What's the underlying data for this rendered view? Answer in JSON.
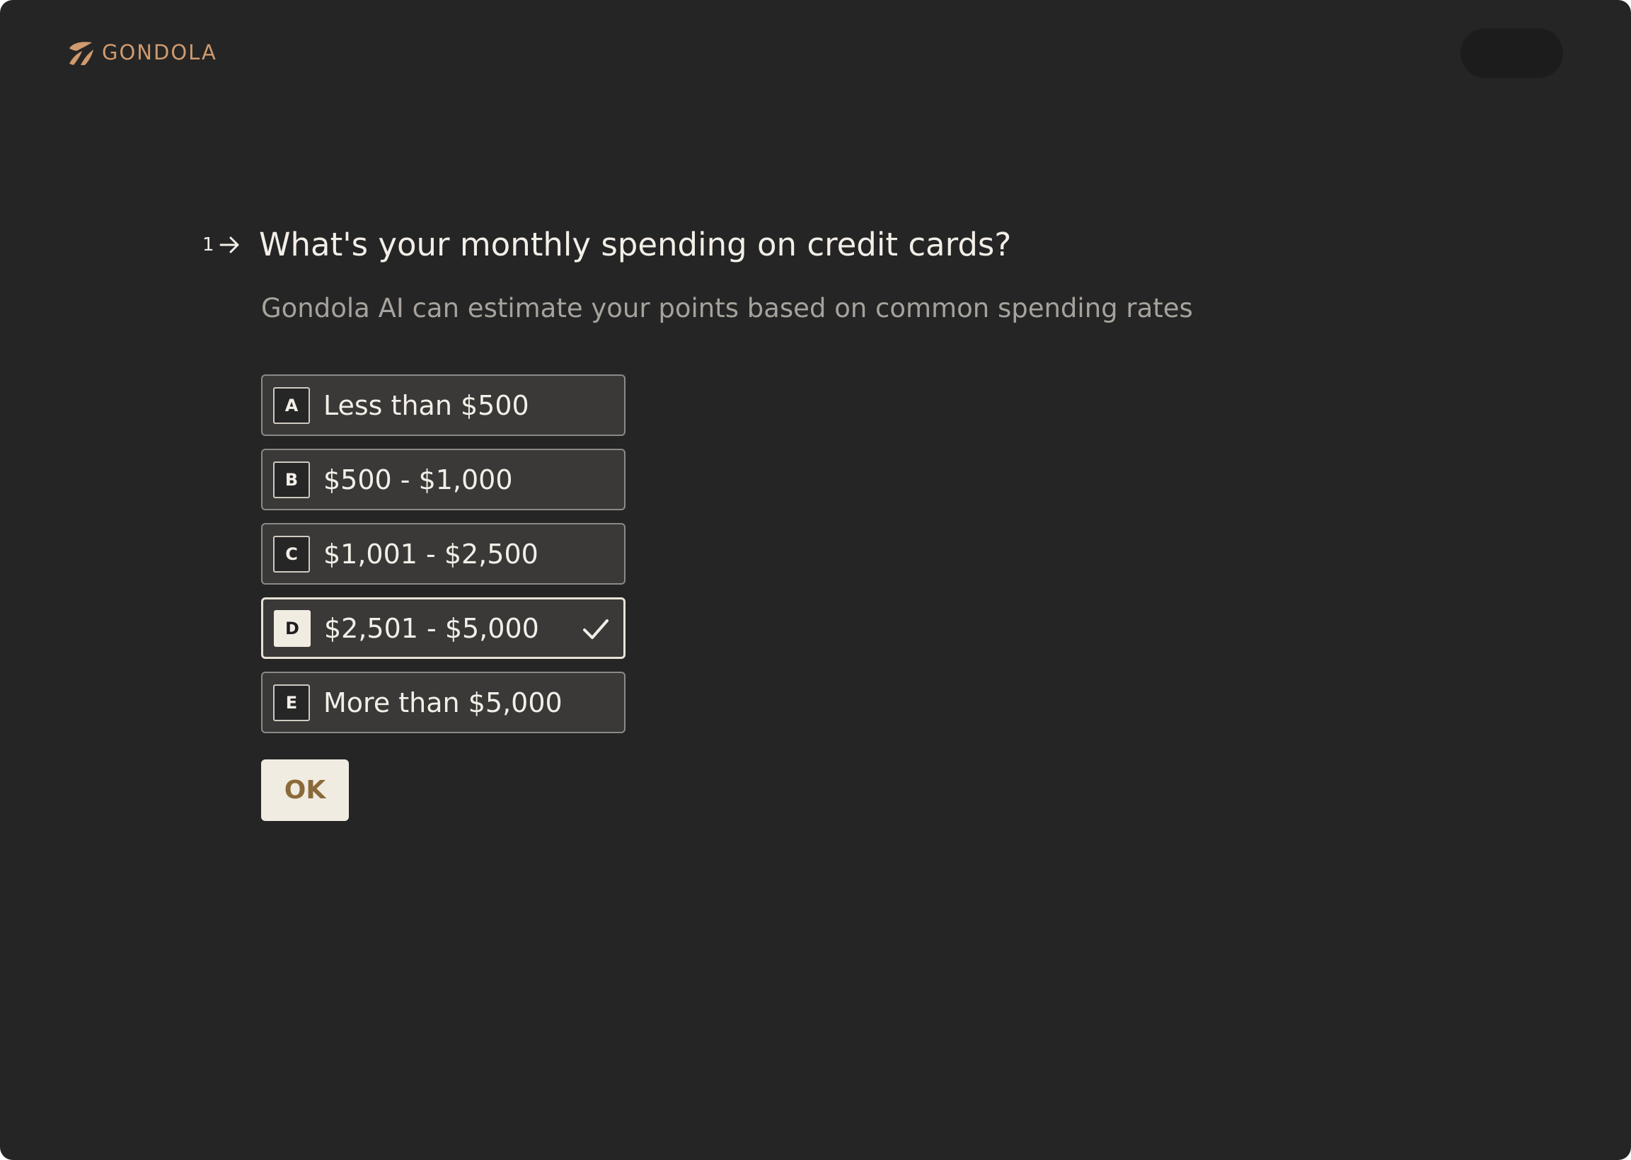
{
  "colors": {
    "background": "#252525",
    "brand": "#d09a6e",
    "title_text": "#f3efe8",
    "subtitle_text": "#a6a29c",
    "option_text": "#f3efe8",
    "ok_bg": "#f1ece2",
    "ok_text": "#8b6a3a"
  },
  "header": {
    "brand_name": "GONDOLA",
    "logo_icon": "gondola-logo-icon"
  },
  "question": {
    "number": "1",
    "arrow_icon": "arrow-right-icon",
    "title": "What's your monthly spending on credit cards?",
    "subtitle": "Gondola AI can estimate your points based on common spending rates"
  },
  "options": [
    {
      "key": "A",
      "label": "Less than $500",
      "selected": false
    },
    {
      "key": "B",
      "label": "$500 - $1,000",
      "selected": false
    },
    {
      "key": "C",
      "label": "$1,001 - $2,500",
      "selected": false
    },
    {
      "key": "D",
      "label": "$2,501 - $5,000",
      "selected": true
    },
    {
      "key": "E",
      "label": "More than $5,000",
      "selected": false
    }
  ],
  "selected_check_icon": "checkmark-icon",
  "ok_button": {
    "label": "OK"
  }
}
